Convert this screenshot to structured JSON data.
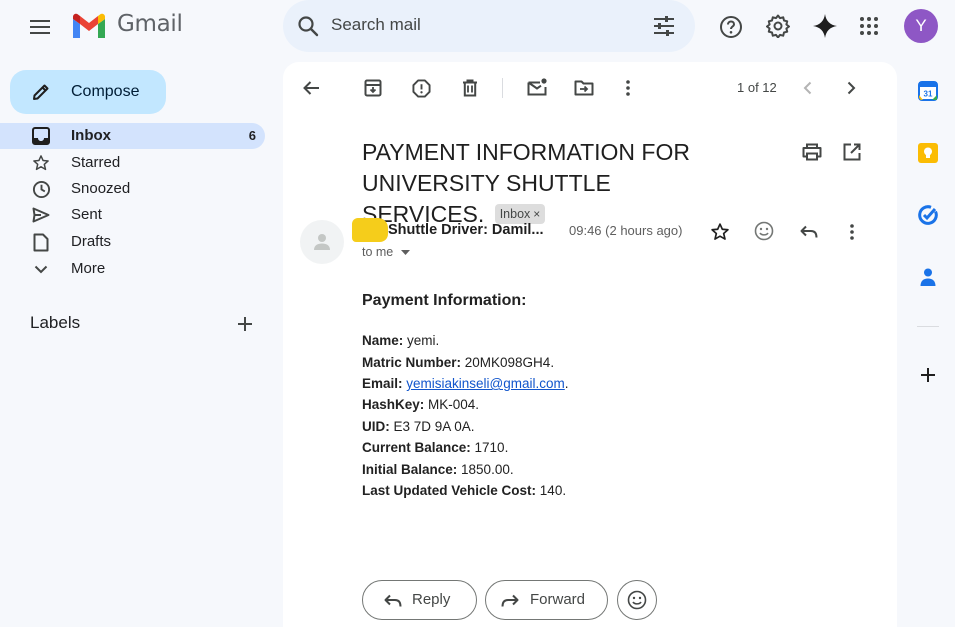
{
  "app": {
    "brand": "Gmail",
    "avatar_letter": "Y",
    "avatar_color": "#8e57c5",
    "accent_color": "#c2e7ff"
  },
  "search": {
    "placeholder": "Search mail"
  },
  "sidebar": {
    "compose_label": "Compose",
    "items": [
      {
        "label": "Inbox",
        "count": "6",
        "icon": "inbox-icon",
        "active": true
      },
      {
        "label": "Starred",
        "icon": "star-icon"
      },
      {
        "label": "Snoozed",
        "icon": "clock-icon"
      },
      {
        "label": "Sent",
        "icon": "send-icon"
      },
      {
        "label": "Drafts",
        "icon": "draft-icon"
      },
      {
        "label": "More",
        "icon": "chevron-down-icon"
      }
    ],
    "labels_title": "Labels"
  },
  "toolbar": {
    "pager": "1 of 12"
  },
  "email": {
    "subject": "PAYMENT INFORMATION FOR UNIVERSITY SHUTTLE SERVICES.",
    "label_chip": "Inbox",
    "label_chip_close": "×",
    "sender": "Shuttle Driver: Damil...",
    "time": "09:46 (2 hours ago)",
    "to": "to me",
    "body_heading": "Payment Information:",
    "fields": [
      {
        "key": "Name:",
        "value": " yemi."
      },
      {
        "key": "Matric Number:",
        "value": " 20MK098GH4."
      },
      {
        "key": "Email:",
        "value": "yemisiakinseli@gmail.com",
        "suffix": ".",
        "link": true
      },
      {
        "key": "HashKey:",
        "value": " MK-004."
      },
      {
        "key": "UID:",
        "value": " E3 7D 9A 0A."
      },
      {
        "key": "Current Balance:",
        "value": " 1710."
      },
      {
        "key": "Initial Balance:",
        "value": " 1850.00."
      },
      {
        "key": "Last Updated Vehicle Cost:",
        "value": " 140."
      }
    ]
  },
  "actions": {
    "reply": "Reply",
    "forward": "Forward"
  }
}
